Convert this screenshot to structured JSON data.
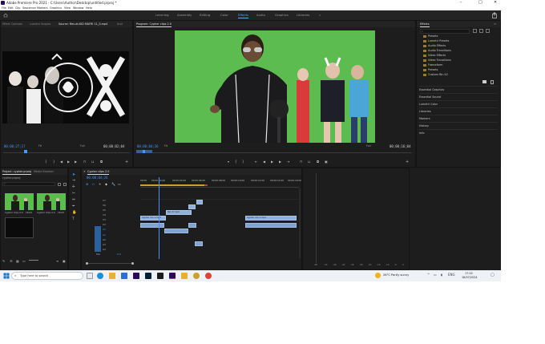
{
  "window": {
    "title": "Adobe Premiere Pro 2021 - C:\\Users\\Author\\Desktop\\untitled.prproj *",
    "controls": {
      "minimize": "–",
      "maximize": "□",
      "close": "✕"
    }
  },
  "menu": [
    "File",
    "Edit",
    "Clip",
    "Sequence",
    "Markers",
    "Graphics",
    "View",
    "Window",
    "Help"
  ],
  "workspaces": {
    "tabs": [
      "Learning",
      "Assembly",
      "Editing",
      "Color",
      "Effects",
      "Audio",
      "Graphics",
      "Libraries"
    ],
    "active": "Effects",
    "overflow": "»"
  },
  "source_monitor": {
    "tabs": [
      "Effect Controls",
      "Lumetri Scopes",
      "Source: Rev-dr-KID MAFRI 11_0.mp4",
      "Aud"
    ],
    "active_tab": "Source: Rev-dr-KID MAFRI 11_0.mp4",
    "timecode": "00;00;27;17",
    "fit": "Fit",
    "quality": "Full",
    "duration": "00;00;02;04"
  },
  "program_monitor": {
    "tab": "Program: Cypher clips 2.0",
    "timecode": "00;00;04;26",
    "fit": "Fit",
    "quality": "Full",
    "duration": "00;00;16;04"
  },
  "effects_panel": {
    "title": "Effects",
    "search_placeholder": "",
    "folders": [
      "Presets",
      "Lumetri Presets",
      "Audio Effects",
      "Audio Transitions",
      "Video Effects",
      "Video Transitions",
      "Frameform",
      "Presets",
      "Custom Bin 42"
    ],
    "sections": [
      "Essential Graphics",
      "Essential Sound",
      "Lumetri Color",
      "Libraries",
      "Markers",
      "History",
      "Info"
    ]
  },
  "project_panel": {
    "tabs": [
      "Project: cypher.prproj",
      "Media Browser"
    ],
    "name": "cypher.prproj",
    "items": [
      {
        "name": "Cypher clips 2.0",
        "duration": "16;04"
      },
      {
        "name": "Cypher clips 2.0",
        "duration": "16;04"
      },
      {
        "name": "",
        "duration": ""
      }
    ]
  },
  "timeline": {
    "tab": "Cypher clips 2.0",
    "timecode": "00;00;04;26",
    "ruler": [
      "00;00",
      "00;00;02;00",
      "00;00;04;00",
      "00;00;06;00",
      "00;00;08;00",
      "00;00;10;00",
      "00;00;12;00",
      "00;00;14;00",
      "00;00;16;00"
    ],
    "video_tracks": [
      "V7",
      "V6",
      "V5",
      "V4",
      "V3",
      "V2",
      "V1"
    ],
    "audio_tracks": [
      "A1",
      "A2",
      "A3",
      "A4"
    ],
    "mix_label": "Mix",
    "mix_value": "0.0",
    "clips": [
      {
        "label": "Cypher clip 1.mp4",
        "track": "V1"
      },
      {
        "label": "Cypher clip 2.mp4",
        "track": "V1"
      },
      {
        "label": "Rev-dr.mp4",
        "track": "V2"
      }
    ]
  },
  "audio_meter": {
    "scale": [
      "0",
      "-6",
      "-12",
      "-18",
      "-24",
      "-30",
      "-36",
      "-42",
      "-48",
      "-54",
      "dB"
    ]
  },
  "taskbar": {
    "search_placeholder": "Type here to search",
    "weather": "26°C  Partly sunny",
    "time": "17:02",
    "date": "18/07/2024"
  },
  "colors": {
    "accent": "#3d9bff",
    "panel_bg": "#1d1d1d",
    "green_screen": "#55b94a",
    "clip_video": "#8fb0d8",
    "clip_audio": "#7fa4d4",
    "playhead": "#4c8dff"
  }
}
